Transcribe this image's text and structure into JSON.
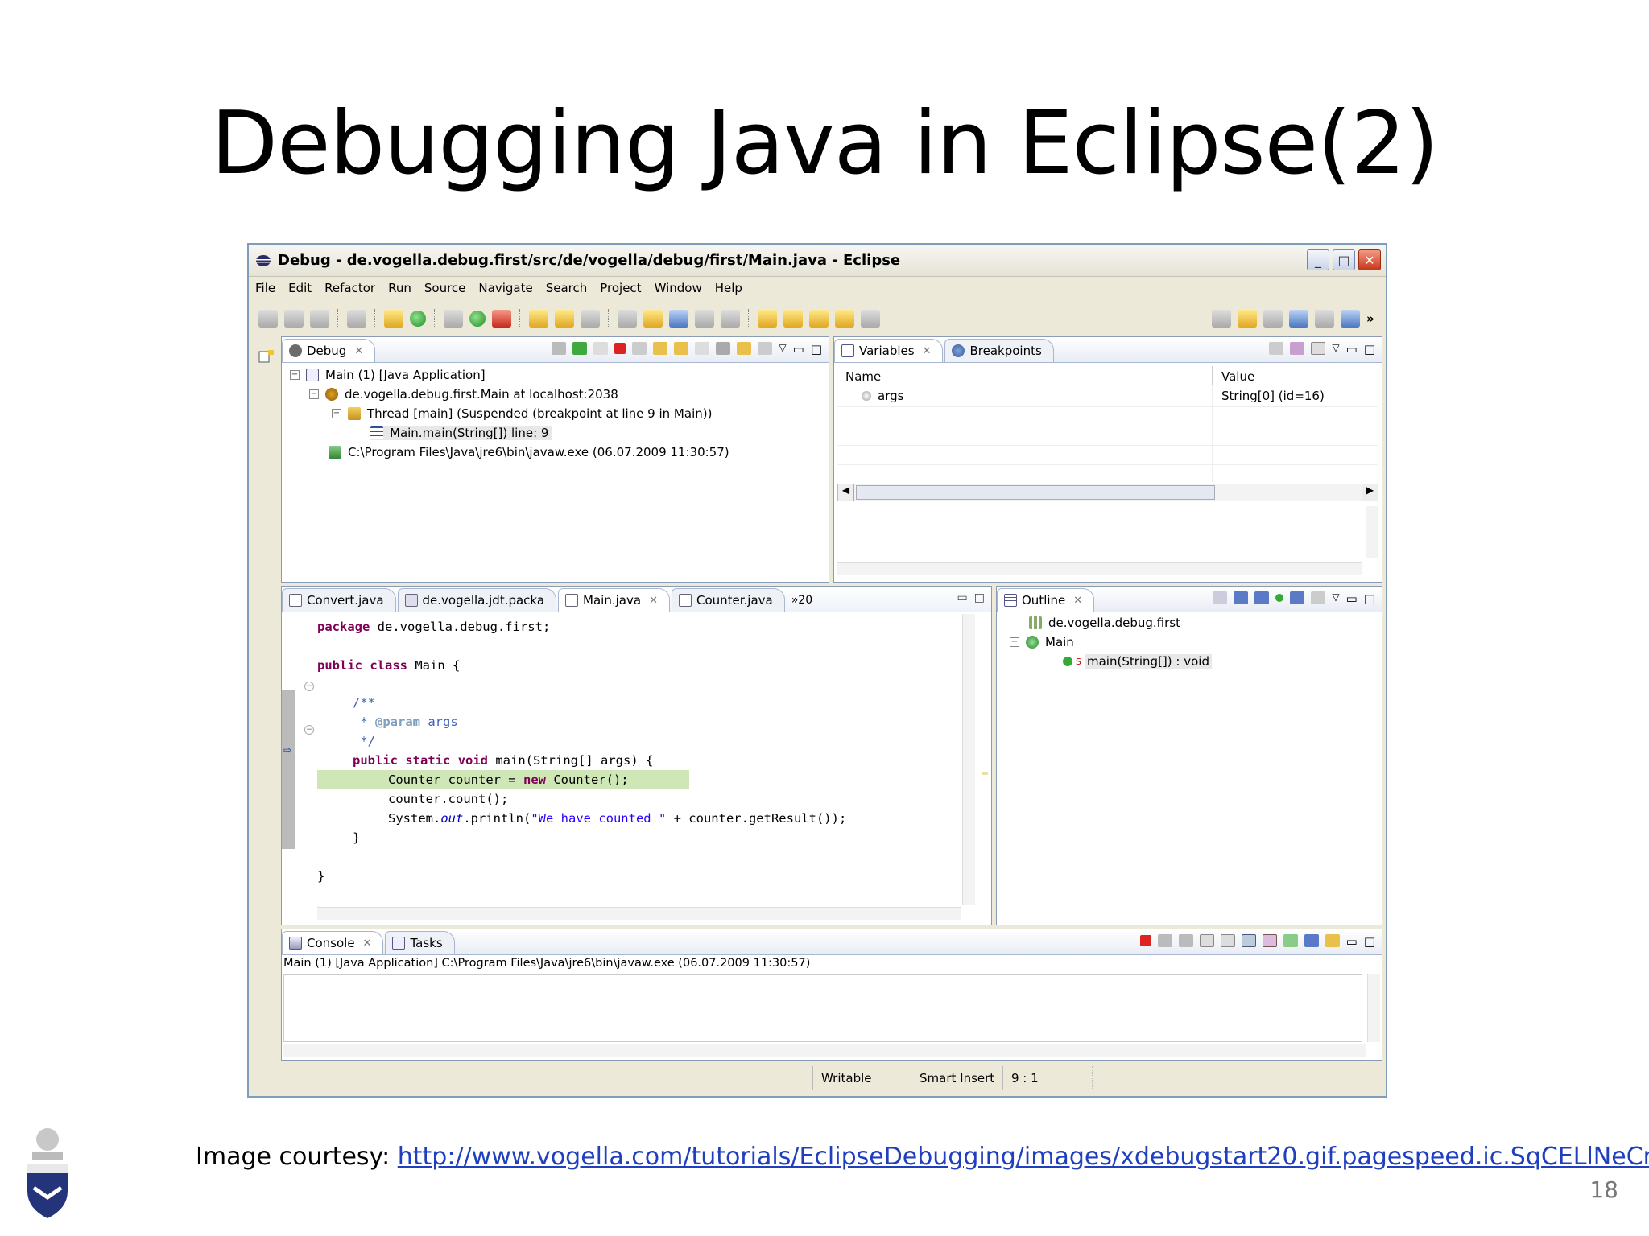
{
  "slide": {
    "title": "Debugging Java in Eclipse(2)",
    "courtesy_label": "Image courtesy: ",
    "courtesy_link": "http://www.vogella.com/tutorials/EclipseDebugging/images/xdebugstart20.gif.pagespeed.ic.SqCELlNeCm.png",
    "page_number": "18"
  },
  "window": {
    "title": "Debug - de.vogella.debug.first/src/de/vogella/debug/first/Main.java - Eclipse",
    "buttons": [
      "_",
      "□",
      "✕"
    ]
  },
  "menu": [
    "File",
    "Edit",
    "Refactor",
    "Run",
    "Source",
    "Navigate",
    "Search",
    "Project",
    "Window",
    "Help"
  ],
  "debug_view": {
    "tab": "Debug",
    "tree": [
      "Main (1) [Java Application]",
      "de.vogella.debug.first.Main at localhost:2038",
      "Thread [main] (Suspended (breakpoint at line 9 in Main))",
      "Main.main(String[]) line: 9",
      "C:\\Program Files\\Java\\jre6\\bin\\javaw.exe (06.07.2009 11:30:57)"
    ]
  },
  "variables_view": {
    "tabs": [
      "Variables",
      "Breakpoints"
    ],
    "columns": [
      "Name",
      "Value"
    ],
    "rows": [
      {
        "name": "args",
        "value": "String[0]  (id=16)"
      }
    ]
  },
  "editor": {
    "tabs": [
      "Convert.java",
      "de.vogella.jdt.packa",
      "Main.java",
      "Counter.java"
    ],
    "overflow": "»20"
  },
  "outline_view": {
    "tab": "Outline",
    "items": [
      "de.vogella.debug.first",
      "Main",
      "main(String[]) : void"
    ],
    "static_marker": "S"
  },
  "console_view": {
    "tabs": [
      "Console",
      "Tasks"
    ],
    "header": "Main (1) [Java Application] C:\\Program Files\\Java\\jre6\\bin\\javaw.exe (06.07.2009 11:30:57)"
  },
  "status_bar": {
    "writable": "Writable",
    "insert_mode": "Smart Insert",
    "position": "9 : 1"
  }
}
